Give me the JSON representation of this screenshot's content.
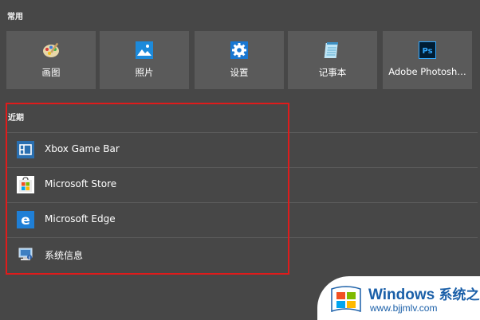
{
  "sections": {
    "common_label": "常用",
    "recent_label": "近期"
  },
  "pinned_tiles": [
    {
      "label": "画图",
      "icon": "paint-palette-icon"
    },
    {
      "label": "照片",
      "icon": "photos-icon"
    },
    {
      "label": "设置",
      "icon": "settings-gear-icon"
    },
    {
      "label": "记事本",
      "icon": "notepad-icon"
    },
    {
      "label": "Adobe Photosh…",
      "icon": "photoshop-icon"
    }
  ],
  "recent_items": [
    {
      "label": "Xbox Game Bar",
      "icon": "xbox-game-bar-icon"
    },
    {
      "label": "Microsoft Store",
      "icon": "microsoft-store-icon"
    },
    {
      "label": "Microsoft Edge",
      "icon": "microsoft-edge-icon"
    },
    {
      "label": "系统信息",
      "icon": "system-information-icon"
    }
  ],
  "watermark": {
    "brand": "Windows",
    "brand_cn": "系统之家",
    "url": "www.bjjmlv.com"
  },
  "colors": {
    "background": "#474747",
    "tile": "#5a5a5a",
    "highlight_border": "#e01b1b",
    "watermark_blue": "#1a5fa8"
  }
}
